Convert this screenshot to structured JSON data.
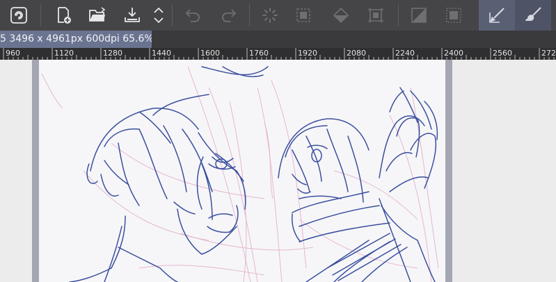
{
  "toolbar": {
    "buttons": [
      {
        "name": "app-menu-icon",
        "active": false
      },
      {
        "name": "new-file-icon",
        "active": false
      },
      {
        "name": "open-folder-icon",
        "active": false
      },
      {
        "name": "save-icon",
        "active": false
      },
      {
        "name": "expand-collapse-icon",
        "active": false
      },
      {
        "name": "undo-icon",
        "active": false
      },
      {
        "name": "redo-icon",
        "active": false
      },
      {
        "name": "spinner-icon",
        "active": false
      },
      {
        "name": "selection-icon",
        "active": false
      },
      {
        "name": "fill-icon",
        "active": false
      },
      {
        "name": "transform-icon",
        "active": false
      },
      {
        "name": "gradient-icon",
        "active": false
      },
      {
        "name": "crop-icon",
        "active": false
      },
      {
        "name": "pen-tool-icon",
        "active": true
      },
      {
        "name": "brush-tool-icon",
        "active": false
      }
    ]
  },
  "document": {
    "tab_label": "5 3496 x 4961px 600dpi 65.6%)"
  },
  "ruler": {
    "labels": [
      "960",
      "1120",
      "1280",
      "1440",
      "1600",
      "1760",
      "1920",
      "2080",
      "2240",
      "2400",
      "2560",
      "272"
    ]
  },
  "colors": {
    "toolbar_bg": "#454548",
    "tab_bg": "#6a7390",
    "ruler_bg": "#2f2f31",
    "sketch_blue": "#3b4f9e",
    "sketch_pink": "#e2a7c6"
  }
}
